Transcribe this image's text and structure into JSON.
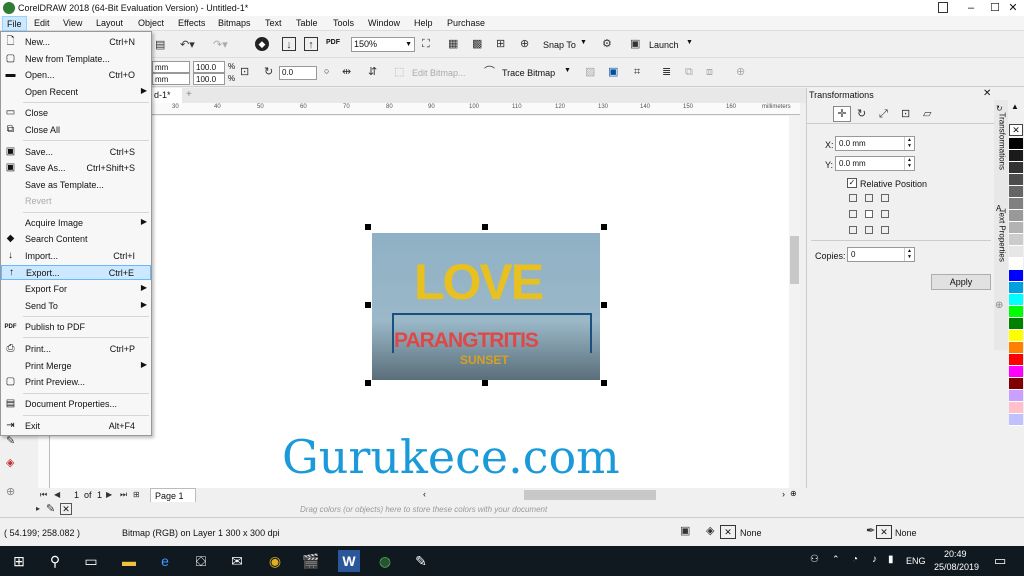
{
  "window": {
    "title": "CorelDRAW 2018 (64-Bit Evaluation Version) - Untitled-1*",
    "controls": [
      "–",
      "☐",
      "✕"
    ]
  },
  "menubar": [
    "File",
    "Edit",
    "View",
    "Layout",
    "Object",
    "Effects",
    "Bitmaps",
    "Text",
    "Table",
    "Tools",
    "Window",
    "Help",
    "Purchase"
  ],
  "toolbar": {
    "zoom": "150%",
    "snap_to": "Snap To",
    "launch": "Launch",
    "pdf": "PDF"
  },
  "propbar": {
    "width_unit": "mm",
    "height_unit": "mm",
    "scale_x": "100.0",
    "scale_y": "100.0",
    "pct": "%",
    "angle": "0.0",
    "edit_bitmap": "Edit Bitmap...",
    "trace_bitmap": "Trace Bitmap"
  },
  "doc_tab": "d-1*",
  "ruler": {
    "ticks": [
      "30",
      "40",
      "50",
      "60",
      "70",
      "80",
      "90",
      "100",
      "110",
      "120",
      "130",
      "140",
      "150",
      "160"
    ],
    "unit": "millimeters"
  },
  "file_menu": [
    {
      "label": "New...",
      "shortcut": "Ctrl+N"
    },
    {
      "label": "New from Template...",
      "shortcut": ""
    },
    {
      "label": "Open...",
      "shortcut": "Ctrl+O"
    },
    {
      "label": "Open Recent",
      "shortcut": "",
      "submenu": true
    },
    {
      "label": "Close",
      "shortcut": ""
    },
    {
      "label": "Close All",
      "shortcut": ""
    },
    {
      "label": "Save...",
      "shortcut": "Ctrl+S"
    },
    {
      "label": "Save As...",
      "shortcut": "Ctrl+Shift+S"
    },
    {
      "label": "Save as Template...",
      "shortcut": ""
    },
    {
      "label": "Revert",
      "shortcut": "",
      "disabled": true
    },
    {
      "label": "Acquire Image",
      "shortcut": "",
      "submenu": true
    },
    {
      "label": "Search Content",
      "shortcut": ""
    },
    {
      "label": "Import...",
      "shortcut": "Ctrl+I"
    },
    {
      "label": "Export...",
      "shortcut": "Ctrl+E",
      "highlighted": true
    },
    {
      "label": "Export For",
      "shortcut": "",
      "submenu": true
    },
    {
      "label": "Send To",
      "shortcut": "",
      "submenu": true
    },
    {
      "label": "Publish to PDF",
      "shortcut": ""
    },
    {
      "label": "Print...",
      "shortcut": "Ctrl+P"
    },
    {
      "label": "Print Merge",
      "shortcut": "",
      "submenu": true
    },
    {
      "label": "Print Preview...",
      "shortcut": ""
    },
    {
      "label": "Document Properties...",
      "shortcut": ""
    },
    {
      "label": "Exit",
      "shortcut": "Alt+F4"
    }
  ],
  "image": {
    "top_text": "LOVE",
    "bottom_text": "PARANGTRITIS",
    "sub_text": "SUNSET"
  },
  "watermark": "Gurukece.com",
  "pagenav": {
    "current": "1",
    "of": "of",
    "total": "1",
    "tab": "Page 1"
  },
  "docker": {
    "title": "Transformations",
    "x_label": "X:",
    "x_value": "0.0 mm",
    "y_label": "Y:",
    "y_value": "0.0 mm",
    "relative_position": "Relative Position",
    "copies_label": "Copies:",
    "copies_value": "0",
    "apply": "Apply",
    "side_tabs": [
      "Transformations",
      "Text Properties"
    ]
  },
  "palette_colors": [
    "#000000",
    "#1a1a1a",
    "#333333",
    "#4d4d4d",
    "#666666",
    "#808080",
    "#999999",
    "#b3b3b3",
    "#cccccc",
    "#e6e6e6",
    "#ffffff",
    "#0000ff",
    "#00a0e0",
    "#00ffff",
    "#00ff00",
    "#008000",
    "#ffff00",
    "#ff8000",
    "#ff0000",
    "#ff00ff",
    "#800000",
    "#c8a0ff",
    "#ffc0cb",
    "#c0c0ff"
  ],
  "colorbar_hint": "Drag colors (or objects) here to store these colors with your document",
  "status": {
    "coords": "( 54.199; 258.082 )",
    "object_info": "Bitmap (RGB) on Layer 1 300 x 300 dpi",
    "fill": "None",
    "outline": "None"
  },
  "taskbar": {
    "lang": "ENG",
    "time": "20:49",
    "date": "25/08/2019"
  }
}
